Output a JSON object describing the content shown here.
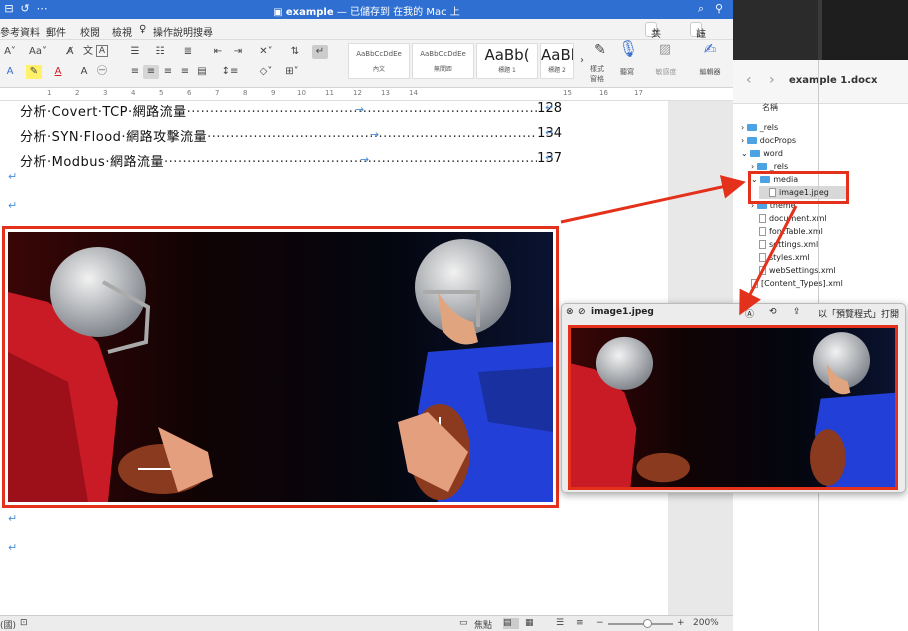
{
  "window": {
    "title": "example",
    "subtitle": "— 已儲存到 在我的 Mac 上"
  },
  "menu": {
    "items": [
      "參考資料",
      "郵件",
      "校閱",
      "檢視"
    ],
    "tell_me": "操作說明搜尋",
    "share": "共用",
    "comment": "註解"
  },
  "ribbon": {
    "styles": [
      {
        "preview": "AaBbCcDdEe",
        "label": "內文"
      },
      {
        "preview": "AaBbCcDdEe",
        "label": "無間距"
      },
      {
        "preview": "AaBb(",
        "label": "標題 1"
      },
      {
        "preview": "AaBb(",
        "label": "標題 2"
      }
    ],
    "styles_pane": "樣式\n窗格",
    "dictate": "聽寫",
    "sensitivity": "敏感度",
    "editor": "編輯器"
  },
  "ruler": {
    "marks": [
      "1",
      "2",
      "3",
      "4",
      "5",
      "6",
      "7",
      "8",
      "9",
      "10",
      "11",
      "12",
      "13",
      "14",
      "15",
      "16",
      "17"
    ]
  },
  "toc": [
    {
      "label": "分析‧Covert‧TCP‧網路流量",
      "page": "128"
    },
    {
      "label": "分析‧SYN‧Flood‧網路攻擊流量",
      "page": "134"
    },
    {
      "label": "分析‧Modbus‧網路流量",
      "page": "137"
    }
  ],
  "status": {
    "left": "(國)",
    "focus": "焦點",
    "zoom": "200%"
  },
  "finder": {
    "title": "example 1.docx",
    "column": "名稱",
    "items": [
      {
        "name": "_rels",
        "kind": "folder",
        "depth": 0,
        "open": false
      },
      {
        "name": "docProps",
        "kind": "folder",
        "depth": 0,
        "open": false
      },
      {
        "name": "word",
        "kind": "folder",
        "depth": 0,
        "open": true
      },
      {
        "name": "_rels",
        "kind": "folder",
        "depth": 1,
        "open": false
      },
      {
        "name": "media",
        "kind": "folder",
        "depth": 1,
        "open": true
      },
      {
        "name": "image1.jpeg",
        "kind": "file",
        "depth": 2,
        "open": false
      },
      {
        "name": "theme",
        "kind": "folder",
        "depth": 1,
        "open": false
      },
      {
        "name": "document.xml",
        "kind": "file",
        "depth": 1,
        "open": false
      },
      {
        "name": "fontTable.xml",
        "kind": "file",
        "depth": 1,
        "open": false
      },
      {
        "name": "settings.xml",
        "kind": "file",
        "depth": 1,
        "open": false
      },
      {
        "name": "styles.xml",
        "kind": "file",
        "depth": 1,
        "open": false
      },
      {
        "name": "webSettings.xml",
        "kind": "file",
        "depth": 1,
        "open": false
      },
      {
        "name": "[Content_Types].xml",
        "kind": "file",
        "depth": 0,
        "open": false
      }
    ]
  },
  "quicklook": {
    "title": "image1.jpeg",
    "open_with": "以「預覽程式」打開"
  },
  "colors": {
    "word_blue": "#2e6fd1",
    "highlight_red": "#e3311b",
    "jersey_red": "#d11f2a",
    "jersey_blue": "#1f3fd1"
  }
}
